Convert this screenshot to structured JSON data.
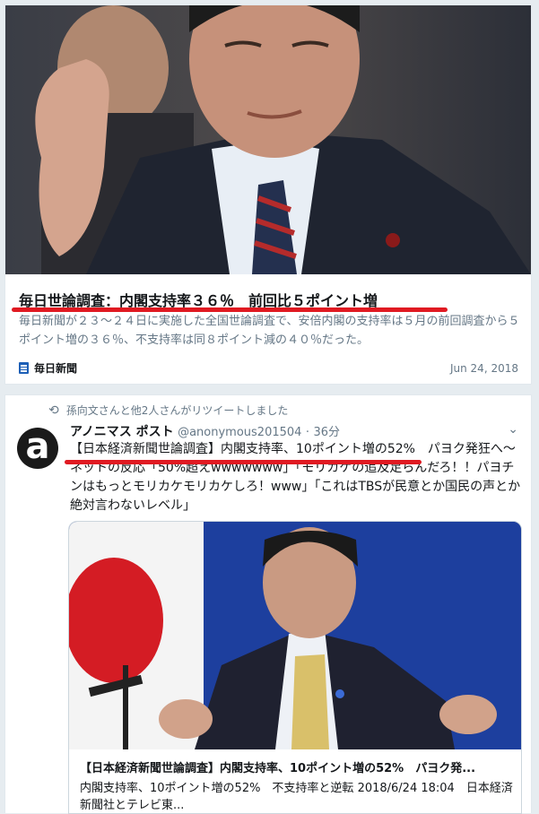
{
  "news": {
    "headline": "毎日世論調査：内閣支持率３６％　前回比５ポイント増",
    "snippet": "毎日新聞が２３～２４日に実施した全国世論調査で、安倍内閣の支持率は５月の前回調査から５ポイント増の３６％、不支持率は同８ポイント減の４０％だった。",
    "source": "毎日新聞",
    "date": "Jun 24, 2018"
  },
  "tweet": {
    "retweet_text": "孫向文さんと他2人さんがリツイートしました",
    "avatar_letter": "a",
    "name": "アノニマス ポスト",
    "handle": "@anonymous201504",
    "dot": "·",
    "time": "36分",
    "text": "【日本経済新聞世論調査】内閣支持率、10ポイント増の52%　パヨク発狂へ～ネットの反応「50%超えwwwwwww」「モリカケの追及足らんだろ！！パヨチンはもっとモリカケモリカケしろ！www」「これはTBSが民意とか国民の声とか絶対言わないレベル」",
    "media": {
      "title": "【日本経済新聞世論調査】内閣支持率、10ポイント増の52%　パヨク発...",
      "description": "内閣支持率、10ポイント増の52%　不支持率と逆転 2018/6/24 18:04　日本経済新聞社とテレビ東..."
    }
  },
  "colors": {
    "highlight_underline": "#e01a22",
    "text_primary": "#14171a",
    "text_secondary": "#657786",
    "background": "#e6ecf0"
  }
}
